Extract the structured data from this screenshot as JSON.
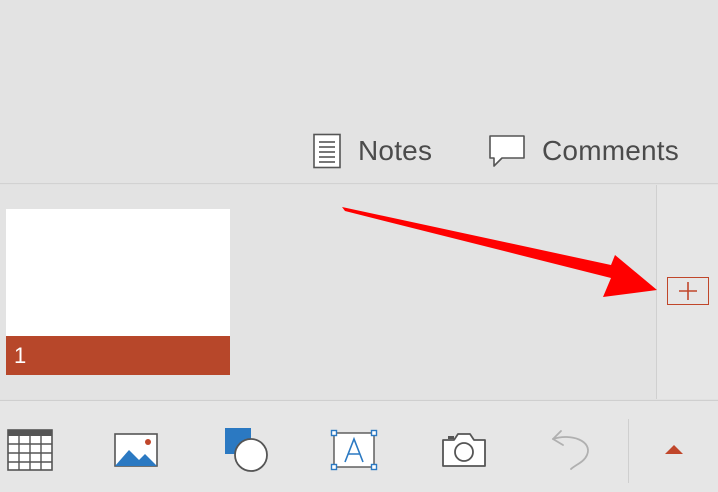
{
  "view_bar": {
    "notes_label": "Notes",
    "comments_label": "Comments"
  },
  "slides": [
    {
      "number": "1"
    }
  ],
  "icons": {
    "notes": "notes-page-icon",
    "comments": "speech-bubble-icon",
    "new_slide": "plus-icon",
    "table": "table-icon",
    "picture": "picture-icon",
    "shapes": "shapes-icon",
    "textbox": "textbox-icon",
    "camera": "camera-icon",
    "undo": "undo-icon",
    "expand": "caret-up-icon",
    "annotation": "red-arrow-annotation"
  },
  "colors": {
    "accent": "#b7472a",
    "accent_border": "#c0462a",
    "annotation_arrow": "#ff0000",
    "icon_blue": "#2b79c2",
    "text": "#4b4b4b",
    "background": "#e3e3e3"
  }
}
